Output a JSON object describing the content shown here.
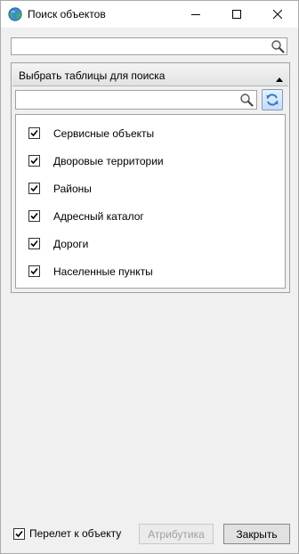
{
  "window": {
    "title": "Поиск объектов",
    "icons": {
      "app": "globe-icon",
      "minimize": "minimize-icon",
      "maximize": "maximize-icon",
      "close": "close-icon"
    }
  },
  "top_search": {
    "value": "",
    "placeholder": "",
    "icon": "search-icon"
  },
  "tables_panel": {
    "header": "Выбрать таблицы для поиска",
    "collapse_icon": "triangle-up-icon",
    "search": {
      "value": "",
      "placeholder": "",
      "icon": "search-icon"
    },
    "refresh_icon": "refresh-icon",
    "items": [
      {
        "label": "Сервисные объекты",
        "checked": true
      },
      {
        "label": "Дворовые территории",
        "checked": true
      },
      {
        "label": "Районы",
        "checked": true
      },
      {
        "label": "Адресный каталог",
        "checked": true
      },
      {
        "label": "Дороги",
        "checked": true
      },
      {
        "label": "Населенные пункты",
        "checked": true
      }
    ]
  },
  "footer": {
    "fly_to_object": {
      "label": "Перелет к объекту",
      "checked": true
    },
    "attributes_button": {
      "label": "Атрибутика",
      "enabled": false
    },
    "close_button": {
      "label": "Закрыть"
    }
  },
  "colors": {
    "background": "#f0f0f0",
    "disabled_text": "#a0a0a0",
    "refresh_accent": "#2e7bd6"
  }
}
